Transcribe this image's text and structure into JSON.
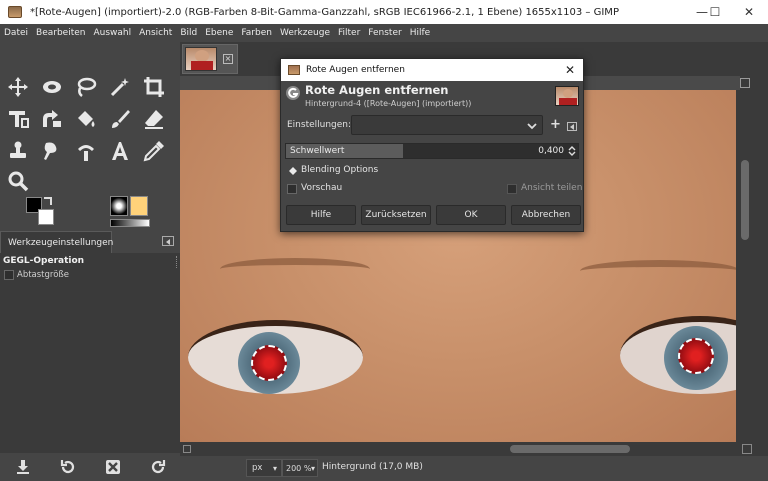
{
  "window": {
    "title": "*[Rote-Augen] (importiert)-2.0 (RGB-Farben 8-Bit-Gamma-Ganzzahl, sRGB IEC61966-2.1, 1 Ebene) 1655x1103 – GIMP",
    "minimize": "—",
    "maximize": "☐",
    "close": "✕"
  },
  "menu": [
    "Datei",
    "Bearbeiten",
    "Auswahl",
    "Ansicht",
    "Bild",
    "Ebene",
    "Farben",
    "Werkzeuge",
    "Filter",
    "Fenster",
    "Hilfe"
  ],
  "tool_options": {
    "tab_label": "Werkzeugeinstellungen",
    "section_label": "GEGL-Operation",
    "checkbox_label": "Abtastgröße"
  },
  "dialog": {
    "window_title": "Rote Augen entfernen",
    "close": "✕",
    "header_title": "Rote Augen entfernen",
    "header_subtitle": "Hintergrund-4 ([Rote-Augen] (importiert))",
    "settings_label": "Einstellungen:",
    "settings_value": "",
    "add_symbol": "+",
    "threshold_label": "Schwellwert",
    "threshold_value": "0,400",
    "threshold_fraction": 0.4,
    "blending_label": "Blending Options",
    "preview_label": "Vorschau",
    "split_label": "Ansicht teilen",
    "buttons": {
      "help": "Hilfe",
      "reset": "Zurücksetzen",
      "ok": "OK",
      "cancel": "Abbrechen"
    }
  },
  "status": {
    "unit": "px",
    "zoom": "200 %",
    "layer_info": "Hintergrund (17,0 MB)"
  },
  "colors": {
    "accent": "#ffd27a",
    "ui_bg": "#454545"
  }
}
